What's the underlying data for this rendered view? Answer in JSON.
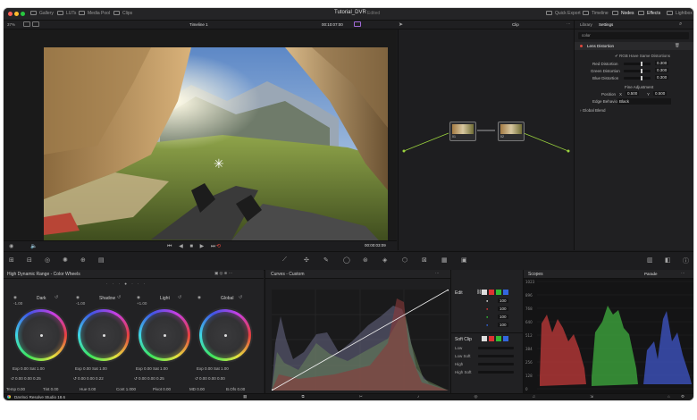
{
  "titlebar": {
    "left_items": [
      "Gallery",
      "LUTs",
      "Media Pool",
      "Clips"
    ],
    "project_title": "Tutorial_DVR",
    "project_status": "Edited",
    "right_items": [
      "Quick Export",
      "Timeline",
      "Nodes",
      "Effects",
      "Lightbox"
    ]
  },
  "viewer_bar": {
    "zoom": "37%",
    "timeline_name": "Timeline 1",
    "timecode_top": "00:10:07:00",
    "clip_label": "Clip",
    "timecode_bottom": "00:00:03:09"
  },
  "settings": {
    "tabs": [
      "Library",
      "Settings"
    ],
    "active_tab": "Settings",
    "search": "color",
    "section": "Lens Distortion",
    "checkbox": "RGB Have Same Distortions",
    "rows": [
      {
        "label": "Red Distortion",
        "value": "0.300",
        "slider": 0.62
      },
      {
        "label": "Green Distortion",
        "value": "0.300",
        "slider": 0.62
      },
      {
        "label": "Blue Distortion",
        "value": "0.300",
        "slider": 0.62
      }
    ],
    "fine_adjustment": "Fine Adjustment",
    "position_label": "Position",
    "pos_x_label": "X",
    "pos_x": "0.500",
    "pos_y_label": "Y",
    "pos_y": "0.500",
    "edge_label": "Edge Behaviour",
    "edge_value": "Black",
    "global_blend": "Global Blend"
  },
  "nodes": {
    "node1": "01",
    "node2": "02"
  },
  "wheels": {
    "title": "High Dynamic Range - Color Wheels",
    "items": [
      {
        "name": "Dark",
        "stat": "-1.00",
        "exp_label": "Exp",
        "exp": "0.00",
        "sat_label": "Sat",
        "sat": "1.00",
        "a": "0.00",
        "b": "0.00",
        "c": "0.25"
      },
      {
        "name": "Shadow",
        "stat": "-1.00",
        "exp_label": "Exp",
        "exp": "0.00",
        "sat_label": "Sat",
        "sat": "1.00",
        "a": "0.00",
        "b": "0.00",
        "c": "0.22"
      },
      {
        "name": "Light",
        "stat": "+1.00",
        "exp_label": "Exp",
        "exp": "0.00",
        "sat_label": "Sat",
        "sat": "1.00",
        "a": "0.00",
        "b": "0.00",
        "c": "0.25"
      },
      {
        "name": "Global",
        "stat": "",
        "exp_label": "Exp",
        "exp": "0.00",
        "sat_label": "Sat",
        "sat": "1.00",
        "a": "0.00",
        "b": "0.00",
        "c": "0.00"
      }
    ],
    "bottom": [
      {
        "label": "Temp",
        "value": "0.00"
      },
      {
        "label": "Tint",
        "value": "0.00"
      },
      {
        "label": "Hue",
        "value": "0.00"
      },
      {
        "label": "Cont",
        "value": "1.000"
      },
      {
        "label": "Pivot",
        "value": "0.00"
      },
      {
        "label": "MD",
        "value": "0.00"
      },
      {
        "label": "B.Ofs",
        "value": "0.00"
      }
    ]
  },
  "curves": {
    "title": "Curves - Custom"
  },
  "edit": {
    "title": "Edit",
    "values": [
      "100",
      "100",
      "100",
      "100"
    ],
    "soft_clip": "Soft Clip",
    "soft_rows": [
      "Low",
      "Low Soft",
      "High",
      "High Soft"
    ]
  },
  "scopes": {
    "title": "Scopes",
    "mode": "Parade",
    "ticks": [
      "1023",
      "896",
      "768",
      "640",
      "512",
      "384",
      "256",
      "128",
      "0"
    ]
  },
  "statusbar": {
    "app": "DaVinci Resolve Studio 18.6"
  }
}
